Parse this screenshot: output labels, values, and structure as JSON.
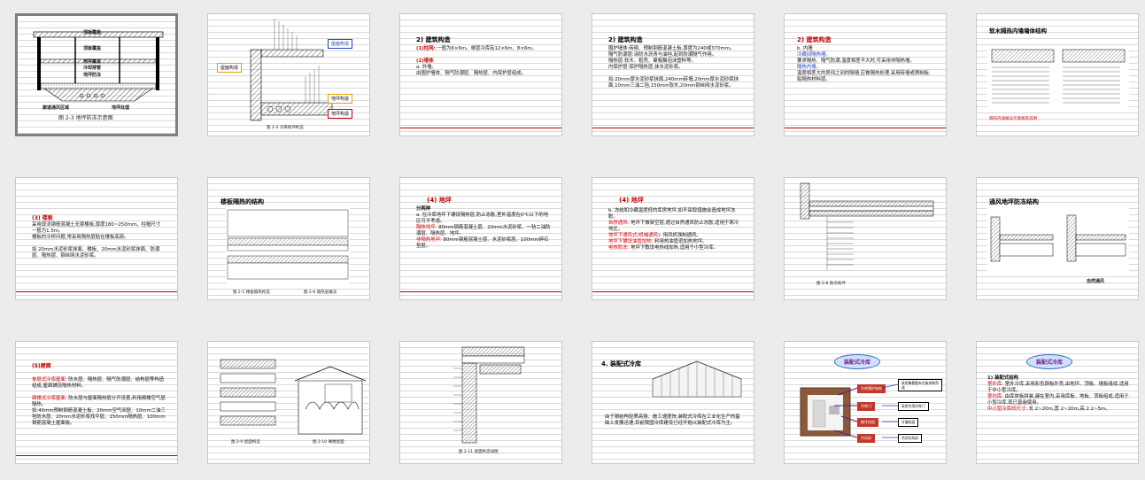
{
  "slides": [
    {
      "id": 1,
      "selected": true,
      "texts": {
        "t1": "顶板覆盖",
        "t2": "顶板覆盖",
        "t3": "冷却排管",
        "t4": "地坪防冻",
        "t5": "地坪覆盖",
        "t6": "廊道通风区域",
        "t7": "地坪处理",
        "caption": "图 2-3   地坪防冻示意图"
      }
    },
    {
      "id": 2,
      "texts": {
        "tag1": "屋面构造",
        "tag2": "屋面构造",
        "tag3": "地坪构造",
        "tag4": "地坪构造",
        "caption": "图 2-4  冷库地坪构造"
      }
    },
    {
      "id": 3,
      "texts": {
        "h": "2) 建筑构造",
        "p1_label": "(1)柱网:",
        "p1": "一般为6×6m。单层冷库有12×6m、8×6m。",
        "p2_label": "(2)墙体",
        "p2a": "a. 外墙。",
        "p2b": "由围护墙体、隔气防潮层、隔热层、内保护层组成。"
      }
    },
    {
      "id": 4,
      "texts": {
        "h": "2) 建筑构造",
        "p1": "围护墙体:砖砌、预制钢筋混凝土板,厚度为240或370mm。",
        "p2": "隔气防潮层:涂防水沥青与油毡,起到防潮隔气作用。",
        "p3": "隔热层:软木、稻壳、聚氨酯泡沫塑料等。",
        "p4": "内保护层:保护隔热层,抹水泥砂浆。",
        "p5": "如:20mm厚水泥砂浆抹面,240mm砖墙,20mm厚水泥砂浆抹面,10mm三油二毡,150mm软木,20mm钢丝网水泥砂浆。"
      }
    },
    {
      "id": 5,
      "texts": {
        "h": "2) 建筑构造",
        "sub": "b. 内墙",
        "p1_label": "冷藏间隔热墙。",
        "p1": "要求隔热、隔气防潮,温度相差不大时,可采用非隔热墙。",
        "p2_label": "隔热内墙。",
        "p2": "温度相差大的房间之间的隔墙,应做隔热处理,采用砖墙或预制板,贴隔热材料层。"
      }
    },
    {
      "id": 6,
      "texts": {
        "h": "软木隔热内墙墙体结构",
        "note": "隔热内墙做法示意图及说明"
      }
    },
    {
      "id": 7,
      "texts": {
        "h": "(3) 楼板",
        "p1": "采用现浇钢筋混凝土无梁楼板,厚度180~250mm。柱帽尺寸一般为1.5m。",
        "p2": "楼板的冷桥问题,常采用隔热层贴在楼板底部。",
        "p3": "如 20mm水泥砂浆抹面、楼板、20mm水泥砂浆抹面、防潮层、隔热层、钢丝网水泥砂浆。"
      }
    },
    {
      "id": 8,
      "texts": {
        "h": "楼板隔热的结构",
        "caption1": "图 2-5 楼板隔热构造",
        "caption2": "图 2-6 隔热层做法"
      }
    },
    {
      "id": 9,
      "texts": {
        "h": "(4) 地坪",
        "sub": "分两种",
        "p1": "a. 在冷库地坪下铺设隔热层,防止冻胀,室外温度在0℃以下的地区可不考虑。",
        "p2_label": "隔热地坪:",
        "p2": "80mm钢筋混凝土层、20mm水泥砂浆、一毡二油防潮层、隔热层、地坪。",
        "p3_label": "非隔热地坪:",
        "p3": "80mm钢筋混凝土层、水泥砂浆层、100mm碎石垫层。"
      }
    },
    {
      "id": 10,
      "texts": {
        "h": "(4) 地坪",
        "p1": "b. 冻结和冷藏温度低的库房地坪,如不采取措施会造成地坪冻胀。",
        "p2_label": "自然通风:",
        "p2": "地坪下做架空层,通过自然通风防止冻胀,适用于寒冷地区。",
        "p3_label": "地坪下通风式(机械通风):",
        "p3": "用风机强制通风。",
        "p4_label": "地坪下铺设油管加热:",
        "p4": "利用热油管道加热地坪。",
        "p5_label": "电热防冻:",
        "p5": "地坪下敷设电热线加热,适用于小型冷库。"
      }
    },
    {
      "id": 11,
      "texts": {
        "caption": "图 2-8 防冻地坪"
      }
    },
    {
      "id": 12,
      "texts": {
        "h": "通风地坪防冻结构",
        "caption": "自然通风"
      }
    },
    {
      "id": 13,
      "texts": {
        "h": "(5)屋面",
        "p1_label": "单层式冷库屋面:",
        "p1": "防水层、隔热层、隔气防潮层、结构层等构造组成,屋面铺设隔热材料。",
        "p2_label": "阁楼式冷库屋面:",
        "p2": "防水层与屋面隔热层分开设置,利用阁楼空气层隔热。",
        "p3": "如:40mm预制钢筋混凝土板、20mm空气间层、10mm二油三毡防水层、20mm水泥砂浆找平层、150mm隔热层、100mm钢筋混凝土屋面板。"
      }
    },
    {
      "id": 14,
      "texts": {
        "caption1": "图 2-9  屋面构造",
        "caption2": "图 2-10 阁楼屋面"
      }
    },
    {
      "id": 15,
      "texts": {
        "caption": "图 2-11  屋面构造详图"
      }
    },
    {
      "id": 16,
      "texts": {
        "h": "4. 装配式冷库",
        "p1": "由于钢结构轻质高强、施工速度快,装配式冷库在工业化生产的基础上发展迅速,目前我国冷库建设已经开始以装配式冷库为主。"
      }
    },
    {
      "id": 17,
      "texts": {
        "title": "装配式冷库",
        "b1": "冷库围护结构",
        "b2": "冷库门",
        "b3": "制冷机组",
        "b4": "冷风机",
        "r1": "采用聚氨酯夹芯板拼装而成",
        "r2": "采用专用冷库门",
        "r3": "冷凝机组",
        "r4": "吊顶冷风机"
      }
    },
    {
      "id": 18,
      "texts": {
        "title": "装配式冷库",
        "h": "1) 装配式结构",
        "p1_label": "室外库:",
        "p1": "室外冷库,采用彩色钢板外壳,由地坪、顶板、墙板组成,适用于中小型冷库。",
        "p2_label": "室内库:",
        "p2": "由库体板拼装,建在室内,采用库板、地板、顶板组成,适用于小型冷库,现已普遍使用。",
        "p3_label": "中小型冷库的尺寸:",
        "p3": "长 2~20m,宽 2~20m,高 2.2~5m。"
      }
    }
  ]
}
